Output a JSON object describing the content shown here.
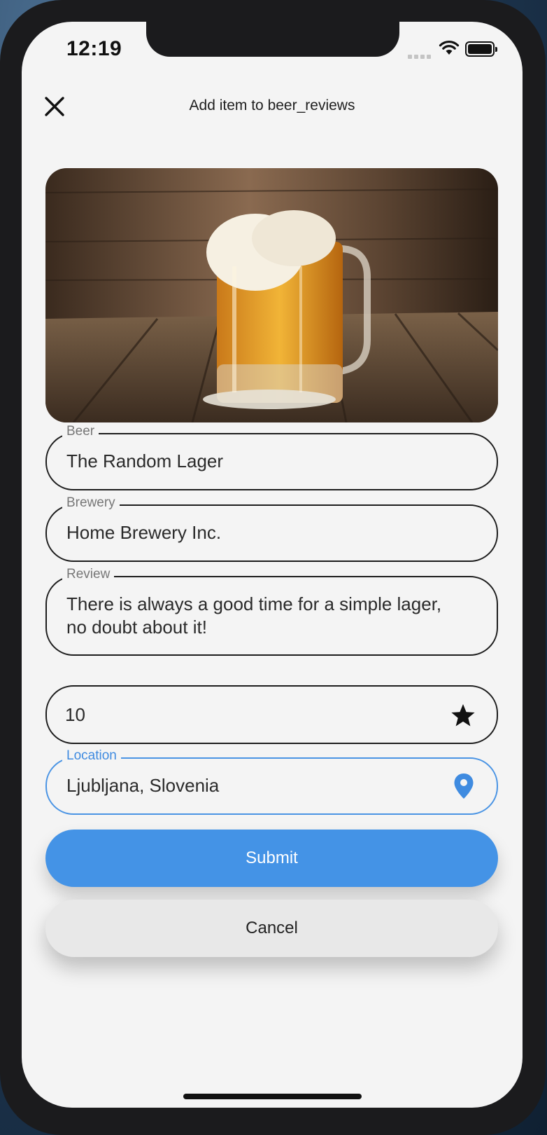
{
  "status_bar": {
    "time": "12:19"
  },
  "header": {
    "title": "Add item to beer_reviews",
    "close_icon": "close-icon"
  },
  "hero_image": {
    "description_icon": "beer-mug-photo"
  },
  "form": {
    "beer": {
      "label": "Beer",
      "value": "The Random Lager"
    },
    "brewery": {
      "label": "Brewery",
      "value": "Home Brewery Inc."
    },
    "review": {
      "label": "Review",
      "value": "There is always a good time for a simple lager, no doubt about it!"
    },
    "rating": {
      "value": "10",
      "icon": "star-icon"
    },
    "location": {
      "label": "Location",
      "value": "Ljubljana, Slovenia",
      "icon": "location-pin-icon"
    }
  },
  "actions": {
    "submit_label": "Submit",
    "cancel_label": "Cancel"
  },
  "colors": {
    "accent": "#4493e6",
    "background": "#f4f4f4",
    "cancel_bg": "#e8e8e8"
  }
}
